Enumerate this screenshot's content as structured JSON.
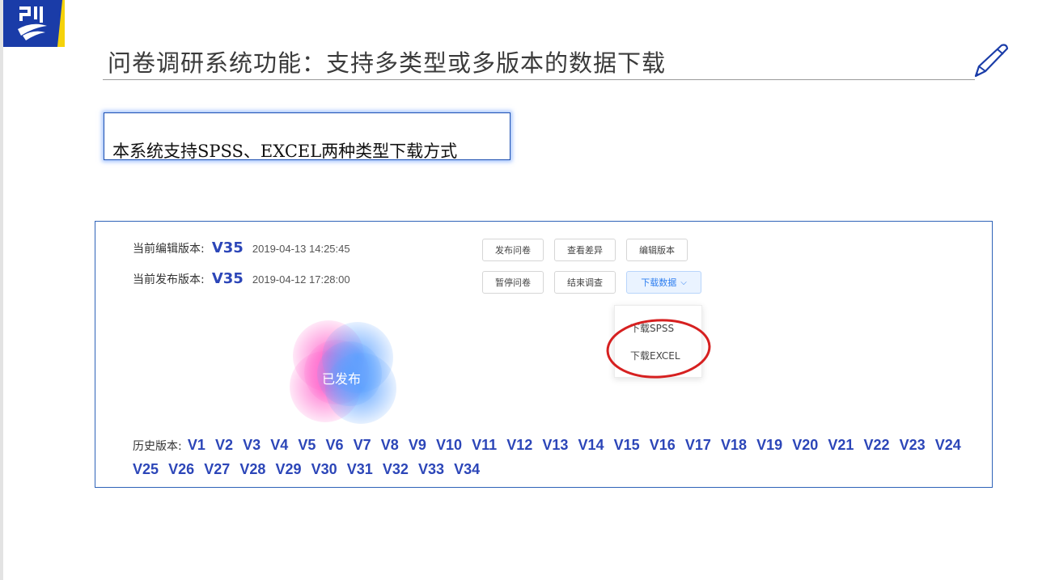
{
  "slide": {
    "title": "问卷调研系统功能：支持多类型或多版本的数据下载",
    "callout_text": "本系统支持SPSS、EXCEL两种类型下载方式"
  },
  "app": {
    "edit_version_label": "当前编辑版本:",
    "edit_version": "V35",
    "edit_version_time": "2019-04-13 14:25:45",
    "publish_version_label": "当前发布版本:",
    "publish_version": "V35",
    "publish_version_time": "2019-04-12 17:28:00",
    "buttons": {
      "publish": "发布问卷",
      "diff": "查看差异",
      "edit_version": "编辑版本",
      "pause": "暂停问卷",
      "end": "结束调查",
      "download": "下载数据"
    },
    "download_menu": [
      "下载SPSS",
      "下载EXCEL"
    ],
    "status": "已发布",
    "history_label": "历史版本:",
    "history_versions": [
      "V1",
      "V2",
      "V3",
      "V4",
      "V5",
      "V6",
      "V7",
      "V8",
      "V9",
      "V10",
      "V11",
      "V12",
      "V13",
      "V14",
      "V15",
      "V16",
      "V17",
      "V18",
      "V19",
      "V20",
      "V21",
      "V22",
      "V23",
      "V24",
      "V25",
      "V26",
      "V27",
      "V28",
      "V29",
      "V30",
      "V31",
      "V32",
      "V33",
      "V34"
    ]
  },
  "colors": {
    "brand_blue": "#1a3ca8",
    "brand_yellow": "#f5d20a",
    "version_blue": "#2c46b8",
    "highlight_red": "#d62020",
    "primary_button": "#2f7ff0"
  }
}
